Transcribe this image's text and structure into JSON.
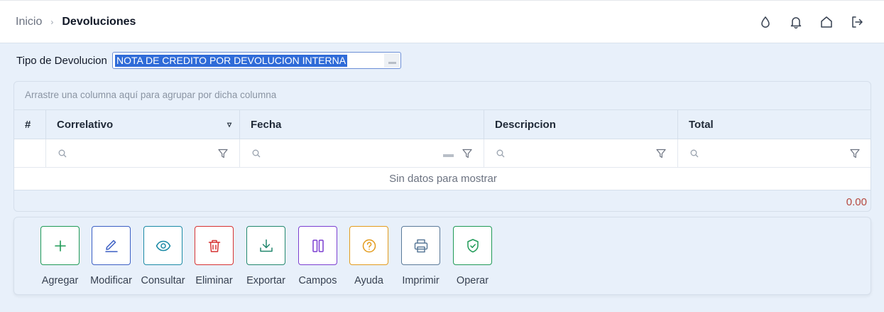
{
  "breadcrumb": {
    "home": "Inicio",
    "separator": "›",
    "current": "Devoluciones"
  },
  "header_icons": [
    "drop-icon",
    "bell-icon",
    "home-icon",
    "logout-icon"
  ],
  "filter": {
    "label": "Tipo de Devolucion",
    "value": "NOTA DE CREDITO POR DEVOLUCION INTERNA"
  },
  "grid": {
    "group_panel_text": "Arrastre una columna aquí para agrupar por dicha columna",
    "columns": [
      {
        "label": "#"
      },
      {
        "label": "Correlativo",
        "sort_indicator": "▿"
      },
      {
        "label": "Fecha"
      },
      {
        "label": "Descripcion"
      },
      {
        "label": "Total"
      }
    ],
    "empty_text": "Sin datos para mostrar",
    "total_summary": "0.00"
  },
  "actions": [
    {
      "label": "Agregar",
      "icon": "plus-icon",
      "color": "#1f9a57"
    },
    {
      "label": "Modificar",
      "icon": "pencil-icon",
      "color": "#3b5fc4"
    },
    {
      "label": "Consultar",
      "icon": "eye-icon",
      "color": "#1b8aa6"
    },
    {
      "label": "Eliminar",
      "icon": "trash-icon",
      "color": "#d63333"
    },
    {
      "label": "Exportar",
      "icon": "download-icon",
      "color": "#22876e"
    },
    {
      "label": "Campos",
      "icon": "columns-icon",
      "color": "#7b3fd1"
    },
    {
      "label": "Ayuda",
      "icon": "help-icon",
      "color": "#e39b1c"
    },
    {
      "label": "Imprimir",
      "icon": "printer-icon",
      "color": "#5b7a99"
    },
    {
      "label": "Operar",
      "icon": "shield-check-icon",
      "color": "#1f9a57"
    }
  ],
  "colors": {
    "accent": "#2f6bd8",
    "total_text": "#b5483e",
    "background": "#e8f0fa"
  }
}
